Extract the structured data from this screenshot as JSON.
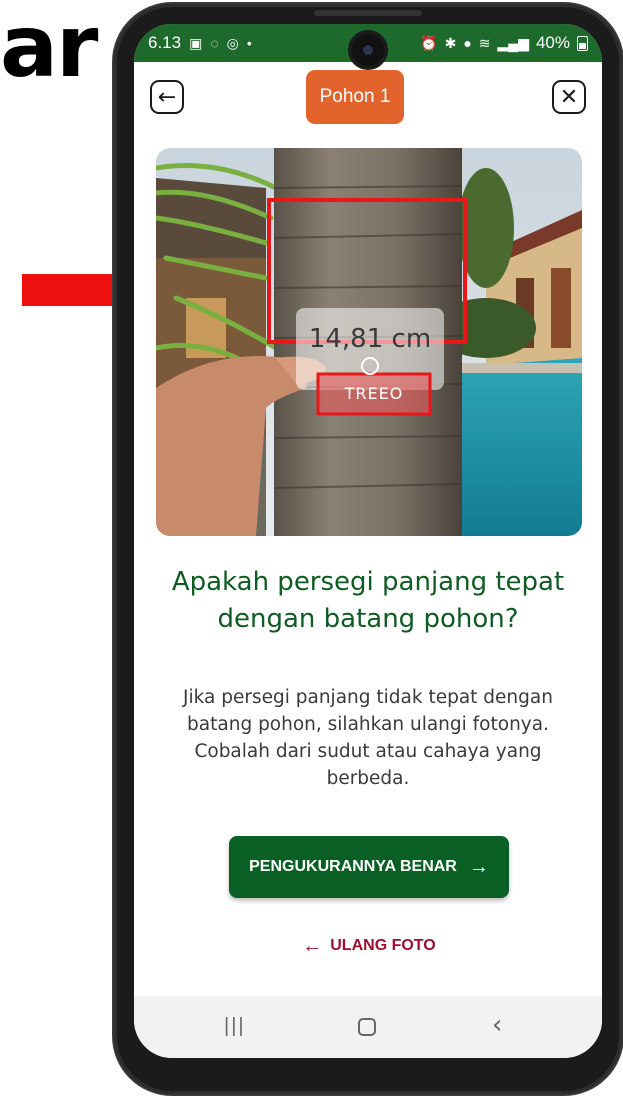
{
  "background_text": "ar",
  "status_bar": {
    "time": "6.13",
    "battery": "40%",
    "left_icons": [
      "gallery-icon",
      "whatsapp-icon",
      "instagram-icon",
      "dot-icon"
    ],
    "right_icons": [
      "alarm-icon",
      "bluetooth-icon",
      "location-icon",
      "wifi-icon",
      "signal-icon",
      "battery-icon"
    ]
  },
  "header": {
    "tree_label": "Pohon 1",
    "back_icon": "back-arrow-icon",
    "close_icon": "close-icon"
  },
  "photo": {
    "measurement": "14,81 cm",
    "card_brand": "TREEO"
  },
  "question": "Apakah persegi panjang tepat dengan batang pohon?",
  "hint": "Jika persegi panjang tidak tepat dengan batang pohon, silahkan ulangi fotonya. Cobalah dari sudut atau cahaya yang berbeda.",
  "actions": {
    "confirm_label": "PENGUKURANNYA BENAR",
    "retake_label": "ULANG FOTO"
  },
  "colors": {
    "status_bar": "#1e6a2c",
    "chip": "#e3632c",
    "primary": "#0a6024",
    "retake": "#9b1030",
    "heading": "#0f5b23",
    "annotation_arrow": "#ee1010"
  }
}
